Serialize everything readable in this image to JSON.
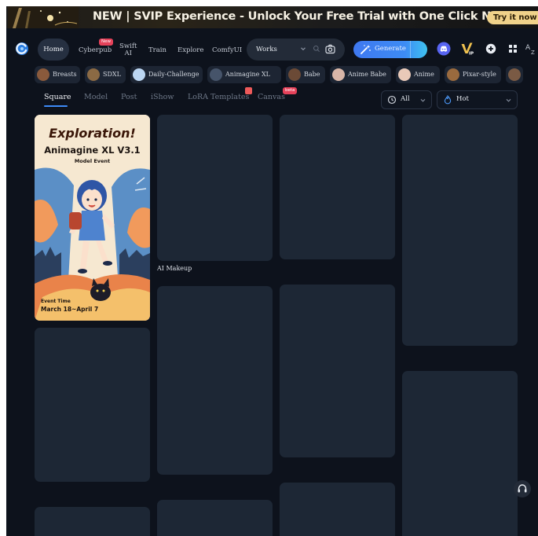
{
  "banner": {
    "message": "NEW | SVIP Experience - Unlock Your Free Trial with One Click Now!",
    "cta": "Try it now »"
  },
  "nav": {
    "home": "Home",
    "cyberpub": "Cyberpub",
    "cyberpub_badge": "New",
    "swift_line1": "Swift",
    "swift_line2": "AI",
    "train": "Train",
    "explore": "Explore",
    "comfyui": "ComfyUI",
    "search_scope": "Works",
    "generate": "Generate"
  },
  "chips": [
    {
      "label": "Breasts",
      "color": "#8a5a3c"
    },
    {
      "label": "SDXL",
      "color": "#8b6a44"
    },
    {
      "label": "Daily-Challenge",
      "color": "#bcd6f2"
    },
    {
      "label": "Animagine XL",
      "color": "#46546a"
    },
    {
      "label": "Babe",
      "color": "#6b4a36"
    },
    {
      "label": "Anime Babe",
      "color": "#d8b6a8"
    },
    {
      "label": "Anime",
      "color": "#e9c9b8"
    },
    {
      "label": "Pixar-style",
      "color": "#9a6a3e"
    }
  ],
  "tabs": {
    "square": "Square",
    "model": "Model",
    "post": "Post",
    "ishow": "iShow",
    "lora": "LoRA Templates",
    "canvas": "Canvas",
    "canvas_badge": "beta"
  },
  "filters": {
    "time": "All",
    "sort": "Hot"
  },
  "feed": {
    "poster": {
      "title": "Exploration!",
      "subtitle": "Animagine XL V3.1",
      "tagline": "Model Event",
      "event_label": "Event Time",
      "event_dates": "March 18~April 7"
    },
    "caption_ai_makeup": "AI Makeup"
  },
  "colors": {
    "background": "#0d121c",
    "card": "#1d2735",
    "accent": "#3e8bf7"
  }
}
